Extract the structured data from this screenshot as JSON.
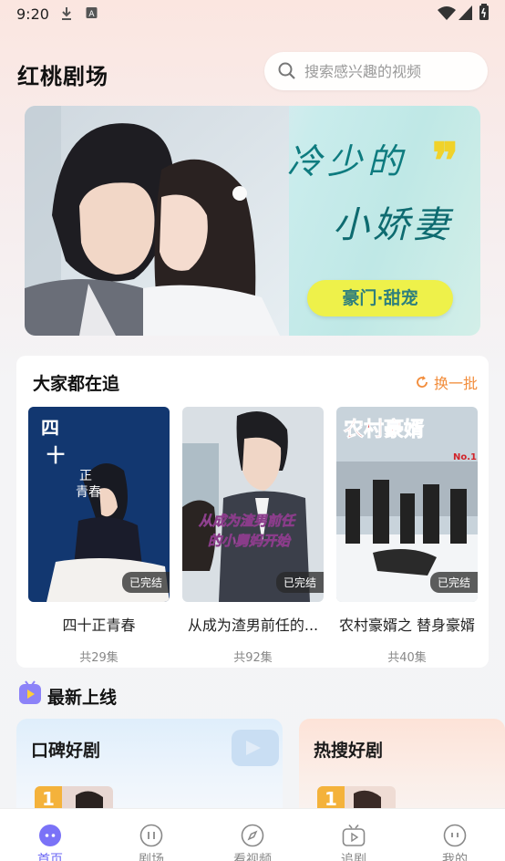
{
  "status_bar": {
    "time": "9:20"
  },
  "header": {
    "app_title": "红桃剧场",
    "search_placeholder": "搜索感兴趣的视频"
  },
  "banner": {
    "title_line1": "冷少的",
    "title_line2": "小娇妻",
    "tag": "豪门·甜宠"
  },
  "trending": {
    "title": "大家都在追",
    "refresh_label": "换一批",
    "items": [
      {
        "name": "四十正青春",
        "episodes": "共29集",
        "status": "已完结",
        "poster_text": "四十正青春"
      },
      {
        "name": "从成为渣男前任的...",
        "episodes": "共92集",
        "status": "已完结",
        "poster_text": "从成为渣男前任的小舅妈开始"
      },
      {
        "name": "农村豪婿之 替身豪婿",
        "episodes": "共40集",
        "status": "已完结",
        "poster_text": "农村豪婿"
      }
    ]
  },
  "new_online": {
    "title": "最新上线",
    "cards": [
      {
        "title": "口碑好剧",
        "rank": "1"
      },
      {
        "title": "热搜好剧",
        "rank": "1"
      }
    ]
  },
  "bottom_nav": [
    {
      "label": "首页",
      "active": true
    },
    {
      "label": "剧场",
      "active": false
    },
    {
      "label": "看视频",
      "active": false
    },
    {
      "label": "追剧",
      "active": false
    },
    {
      "label": "我的",
      "active": false
    }
  ],
  "colors": {
    "accent": "#6b67f5",
    "refresh": "#f28c3a",
    "banner_tag": "#eef14a"
  }
}
